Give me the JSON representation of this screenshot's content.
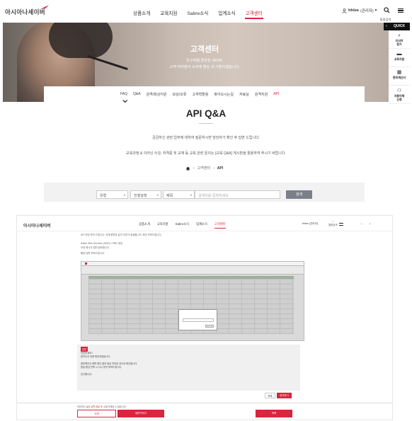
{
  "header": {
    "logo": "아시아나세이버",
    "nav": [
      "상품소개",
      "교육지원",
      "Sabre소식",
      "업계소식",
      "고객센터"
    ],
    "active_nav": "고객센터",
    "user_name": "hhlee",
    "user_role": "(관리자)",
    "search_label": "통합검색"
  },
  "hero": {
    "title": "고객센터",
    "subtitle_line1": "친구처럼 편안한 세이버,",
    "subtitle_line2": "고객 여러분의 소리에 항상 귀 기울이겠습니다."
  },
  "quick": {
    "label": "QUICK",
    "items": [
      {
        "icon": "search-icon",
        "label1": "지식어",
        "label2": "찾기"
      },
      {
        "icon": "book-icon",
        "label1": "교육지원",
        "label2": ""
      },
      {
        "icon": "calculator-icon",
        "label1": "편의계산서",
        "label2": ""
      },
      {
        "icon": "user-plus-icon",
        "label1": "자동이체",
        "label2": "신청"
      }
    ]
  },
  "tabs": [
    "FAQ",
    "Q&A",
    "원격/화상지원",
    "보상/오류",
    "고객혁할용",
    "찾아오시는길",
    "자료실",
    "원격지원",
    "API"
  ],
  "active_tab": "API",
  "page": {
    "title": "API Q&A",
    "intro1": "궁금하신 관련 업무에 대하여 질문하시면 담당자가 확인 후 답변 드립니다.",
    "intro2": "교육과정 & 이러닝 수강, 자격증 및 교재 등 교육 관련 문의는 [교육 Q&A] 게시판을 활용하여 주시기 바랍니다."
  },
  "breadcrumb": {
    "level1": "고객센터",
    "level2": "API"
  },
  "filters": {
    "type": "유형",
    "status": "진행상태",
    "field": "제목",
    "keyword_placeholder": "검색어를 입력하세요",
    "search_button": "검색"
  },
  "detail": {
    "logo": "아시아나세이버",
    "nav": [
      "상품소개",
      "교육지원",
      "Sabre소식",
      "업계소식",
      "고객센터"
    ],
    "active_nav": "고객센터",
    "user": "hhlee (관리자)",
    "search_label": "통합검색",
    "body_lines": [
      "API 관련 문의 드립니다. 아래 화면과 같이 오류가 발생합니다. 확인 부탁드립니다.",
      "Sabre Web Services (SWS) / PNR 생성",
      "오류 메시지 캡처 첨부합니다.",
      "빠른 답변 부탁드립니다."
    ],
    "answer_badge": "답변",
    "answer_lines": [
      "안녕하세요?",
      "문의주신 내용 확인하였습니다.",
      "",
      "첨부해주신 화면 확인 결과 정상 처리된 것으로 확인됩니다.",
      "동일 증상 반복 시 다시 문의 부탁드립니다.",
      "",
      "감사합니다."
    ],
    "list_button": "목록",
    "question_button": "문의하기",
    "note_prefix": "작성하신 글은",
    "note_highlight": "답변 완료 후",
    "note_suffix": "수정/삭제할 수 없습니다.",
    "delete_button": "삭제",
    "edit_button": "재문의하기",
    "list_button2": "목록"
  }
}
